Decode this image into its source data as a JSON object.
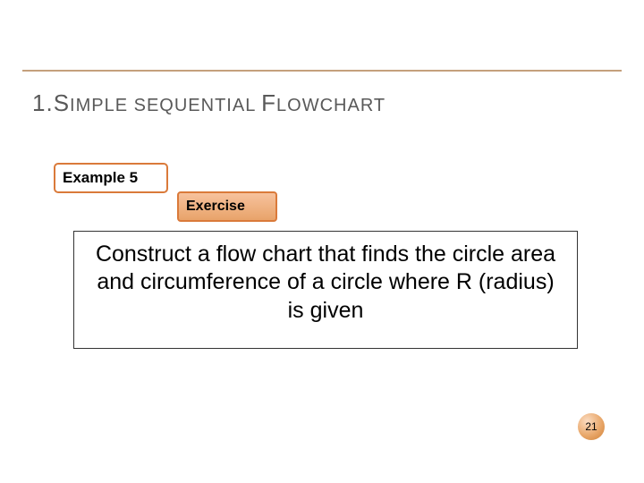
{
  "heading": {
    "num": "1.",
    "caps1_big": "S",
    "word1_small": "IMPLE",
    "space1": " ",
    "word2_small": "SEQUENTIAL",
    "space2": " ",
    "caps2_big": "F",
    "word3_small": "LOWCHART"
  },
  "example_label": "Example 5",
  "exercise_label": "Exercise",
  "body_text": "Construct a flow chart that finds the circle area and circumference of a circle where R (radius) is given",
  "page_number": "21"
}
